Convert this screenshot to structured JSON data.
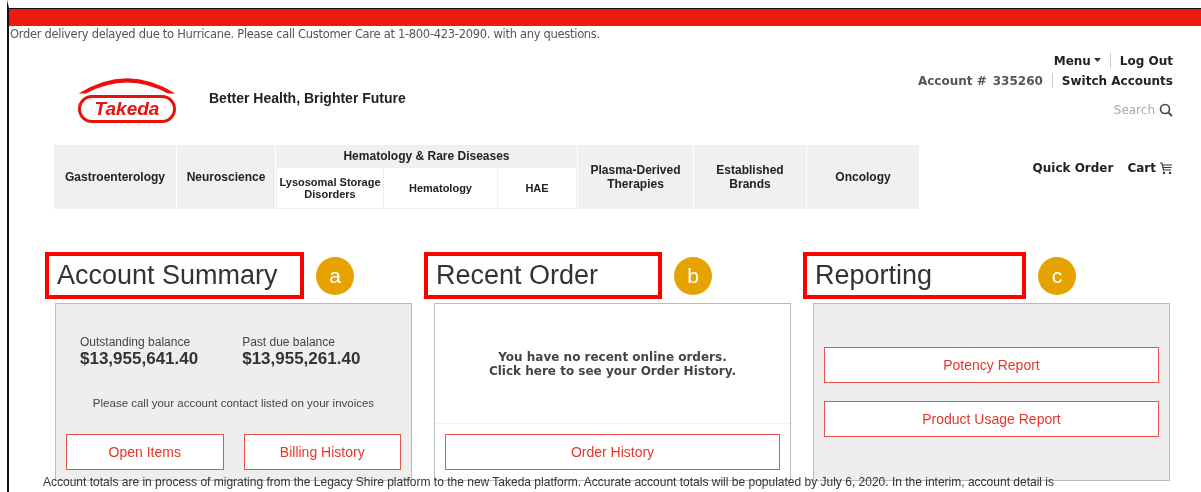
{
  "alert_banner": "Order delivery delayed due to Hurricane. Please call Customer Care at 1-800-423-2090. with any questions.",
  "header": {
    "logo_text": "Takeda",
    "tagline": "Better Health, Brighter Future",
    "menu": "Menu",
    "logout": "Log Out",
    "account_label": "Account #",
    "account_number": "335260",
    "switch_accounts": "Switch Accounts",
    "search": {
      "placeholder": "Search"
    },
    "quick_order": "Quick Order",
    "cart": "Cart"
  },
  "nav": [
    {
      "label": "Gastroenterology"
    },
    {
      "label": "Neuroscience"
    },
    {
      "label": "Hematology & Rare Diseases",
      "children": [
        {
          "label": "Lysosomal Storage Disorders"
        },
        {
          "label": "Hematology"
        },
        {
          "label": "HAE"
        }
      ]
    },
    {
      "label": "Plasma-Derived Therapies"
    },
    {
      "label": "Established Brands"
    },
    {
      "label": "Oncology"
    }
  ],
  "sections": [
    {
      "kind": "account",
      "title": "Account Summary",
      "badge": "a",
      "balances": [
        {
          "label": "Outstanding balance",
          "amount": "$13,955,641.40"
        },
        {
          "label": "Past due balance",
          "amount": "$13,955,261.40"
        }
      ],
      "note": "Please call your account contact listed on your invoices",
      "buttons": [
        "Open Items",
        "Billing History"
      ]
    },
    {
      "kind": "orders",
      "title": "Recent Order",
      "badge": "b",
      "message": "You have no recent online orders.",
      "message_2": "Click **here** to see your Order History.",
      "buttons": [
        "Order History"
      ]
    },
    {
      "kind": "reporting",
      "title": "Reporting",
      "badge": "c",
      "buttons": [
        "Potency Report",
        "Product Usage Report"
      ]
    }
  ],
  "footer_note": "Account totals are in process of migrating from the Legacy Shire platform to the new Takeda platform. Accurate account totals will be populated by July 6, 2020. In the interim, account detail is"
}
